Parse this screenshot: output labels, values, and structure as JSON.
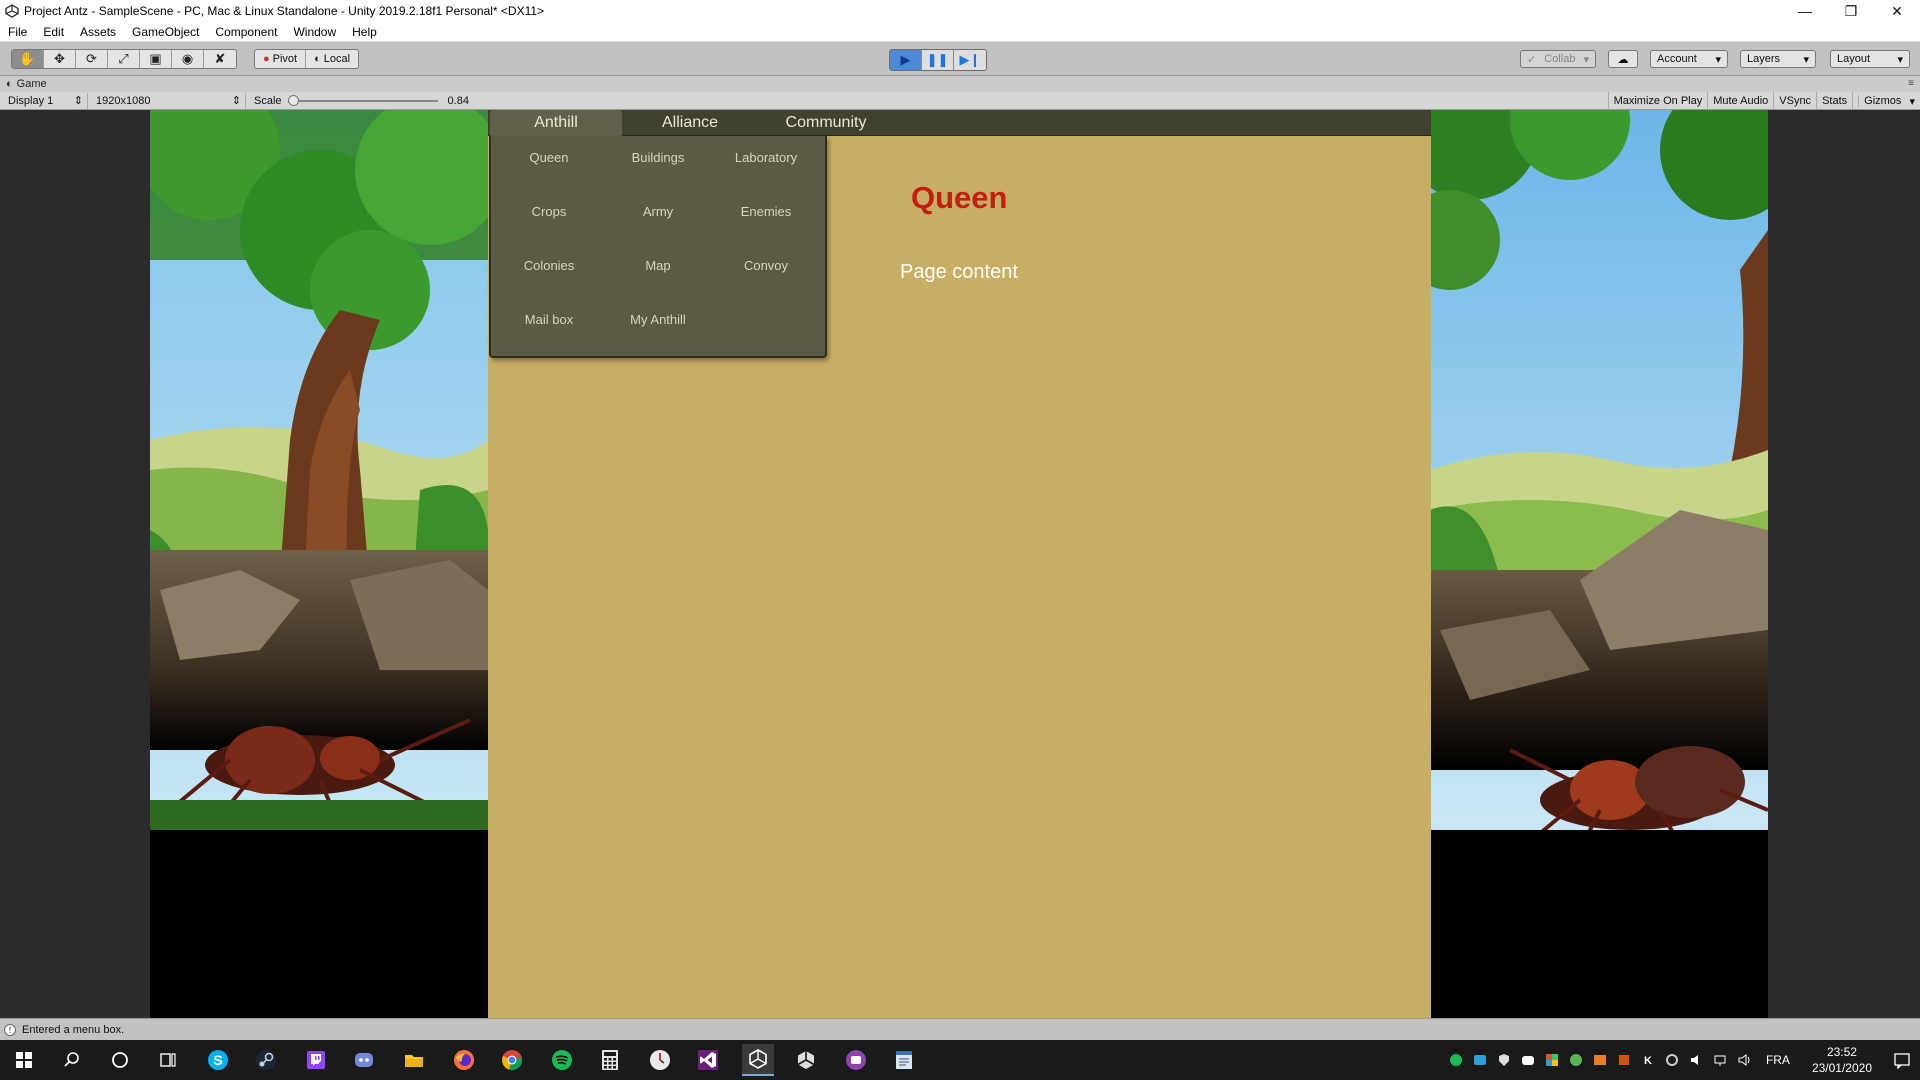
{
  "window": {
    "title": "Project Antz - SampleScene - PC, Mac & Linux Standalone - Unity 2019.2.18f1 Personal* <DX11>",
    "controls": [
      "minimize",
      "restore",
      "close"
    ]
  },
  "menubar": {
    "items": [
      "File",
      "Edit",
      "Assets",
      "GameObject",
      "Component",
      "Window",
      "Help"
    ]
  },
  "toolbar": {
    "tools": [
      "hand-icon",
      "move-icon",
      "rotate-icon",
      "scale-icon",
      "rect-icon",
      "transform-icon",
      "custom-tool-icon"
    ],
    "pivot_label": "Pivot",
    "local_label": "Local",
    "collab_label": "Collab",
    "account_label": "Account",
    "layers_label": "Layers",
    "layout_label": "Layout",
    "play_state": "playing"
  },
  "game_view": {
    "tab_label": "Game",
    "display_label": "Display 1",
    "resolution_label": "1920x1080",
    "scale_label": "Scale",
    "scale_value": "0.84",
    "scale_slider_value": 0.0,
    "toggles": [
      "Maximize On Play",
      "Mute Audio",
      "VSync",
      "Stats",
      "Gizmos"
    ]
  },
  "game": {
    "tabs": [
      {
        "label": "Anthill",
        "active": true
      },
      {
        "label": "Alliance",
        "active": false
      },
      {
        "label": "Community",
        "active": false
      }
    ],
    "submenu": [
      [
        "Queen",
        "Buildings",
        "Laboratory"
      ],
      [
        "Crops",
        "Army",
        "Enemies"
      ],
      [
        "Colonies",
        "Map",
        "Convoy"
      ],
      [
        "Mail box",
        "My Anthill"
      ]
    ],
    "page_title": "Queen",
    "page_content": "Page content",
    "colors": {
      "panel_bg": "#c8ae64",
      "tab_bar": "#41412f",
      "submenu_bg": "#5a5a45",
      "title_red": "#c41e10"
    }
  },
  "status": {
    "message": "Entered a menu box."
  },
  "taskbar": {
    "apps": [
      "windows-start-icon",
      "search-icon",
      "cortana-icon",
      "task-view-icon",
      "skype-icon",
      "steam-icon",
      "twitch-icon",
      "discord-icon",
      "file-explorer-icon",
      "firefox-icon",
      "chrome-icon",
      "spotify-icon",
      "calculator-icon",
      "clock-app-icon",
      "visual-studio-icon",
      "unity-icon",
      "unity-hub-icon",
      "purple-app-icon",
      "notepad-app-icon"
    ],
    "active_app": "unity-icon",
    "language": "FRA",
    "time": "23:52",
    "date": "23/01/2020"
  }
}
